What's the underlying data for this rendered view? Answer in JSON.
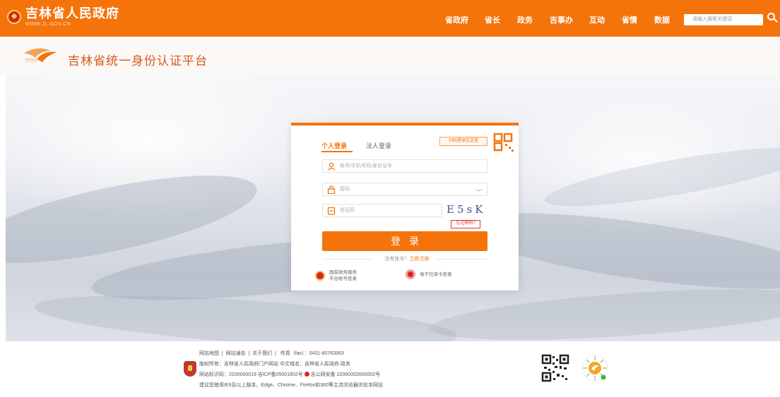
{
  "header": {
    "title": "吉林省人民政府",
    "subtitle": "WWW.JL.GOV.CN",
    "nav": [
      {
        "label": "省政府"
      },
      {
        "label": "省长"
      },
      {
        "label": "政务"
      },
      {
        "label": "吉事办"
      },
      {
        "label": "互动"
      },
      {
        "label": "省情"
      },
      {
        "label": "数据"
      }
    ],
    "search_placeholder": "请输入搜索关键词"
  },
  "platform": {
    "title": "吉林省统一身份认证平台",
    "logo_icon": "platform-bird-logo-icon"
  },
  "login": {
    "tabs": [
      {
        "label": "个人登录",
        "active": true
      },
      {
        "label": "法人登录",
        "active": false
      }
    ],
    "qr_tip": "扫码登录在这里",
    "account_placeholder": "账号/手机号码/身份证号",
    "password_placeholder": "密码",
    "captcha_placeholder": "验证码",
    "captcha_text": "E5sK",
    "forgot_label": "忘记密码?",
    "login_label": "登录",
    "register_prompt": "没有账号？",
    "register_link": "立即注册",
    "alt_national": [
      "国家政务服务",
      "平台账号登录"
    ],
    "alt_social_card": "电子社保卡登录",
    "accent_color": "#f5730b"
  },
  "footer": {
    "links": [
      "网站地图",
      "网站通告",
      "关于我们"
    ],
    "fax": "传真（fax）：0431-80763563",
    "copyright": "版权所有：吉林省人民政府门户网站   中文域名：吉林省人民政府.政务",
    "site_id_icp": "网站标识码：2200000019   吉ICP备05001602号",
    "police_record": "吉公网安备 22000002000002号",
    "browser_tip": "建议您使用IE9及以上版本、Edge、Chrome、Firefox和360等主流浏览器浏览本网站"
  }
}
